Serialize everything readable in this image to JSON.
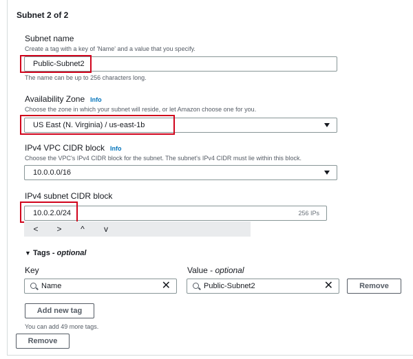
{
  "section": {
    "title": "Subnet 2 of 2"
  },
  "subnet_name": {
    "label": "Subnet name",
    "description": "Create a tag with a key of 'Name' and a value that you specify.",
    "value": "Public-Subnet2",
    "constraint": "The name can be up to 256 characters long."
  },
  "availability_zone": {
    "label": "Availability Zone",
    "info": "Info",
    "description": "Choose the zone in which your subnet will reside, or let Amazon choose one for you.",
    "value": "US East (N. Virginia) / us-east-1b"
  },
  "vpc_cidr": {
    "label": "IPv4 VPC CIDR block",
    "info": "Info",
    "description": "Choose the VPC's IPv4 CIDR block for the subnet. The subnet's IPv4 CIDR must lie within this block.",
    "value": "10.0.0.0/16"
  },
  "subnet_cidr": {
    "label": "IPv4 subnet CIDR block",
    "value": "10.0.2.0/24",
    "ip_count": "256 IPs",
    "stepper": {
      "prev": "<",
      "next": ">",
      "up": "^",
      "down": "v"
    }
  },
  "tags": {
    "toggle_glyph": "▼",
    "title": "Tags",
    "optional": "optional",
    "key_label": "Key",
    "value_label": "Value",
    "value_optional": "optional",
    "key_value": "Name",
    "value_value": "Public-Subnet2",
    "clear_glyph": "✕",
    "remove_tag": "Remove",
    "add_new_tag": "Add new tag",
    "remaining": "You can add 49 more tags."
  },
  "remove_subnet": "Remove",
  "colors": {
    "highlight": "#d0021b",
    "link": "#0073bb",
    "border": "#879596"
  }
}
